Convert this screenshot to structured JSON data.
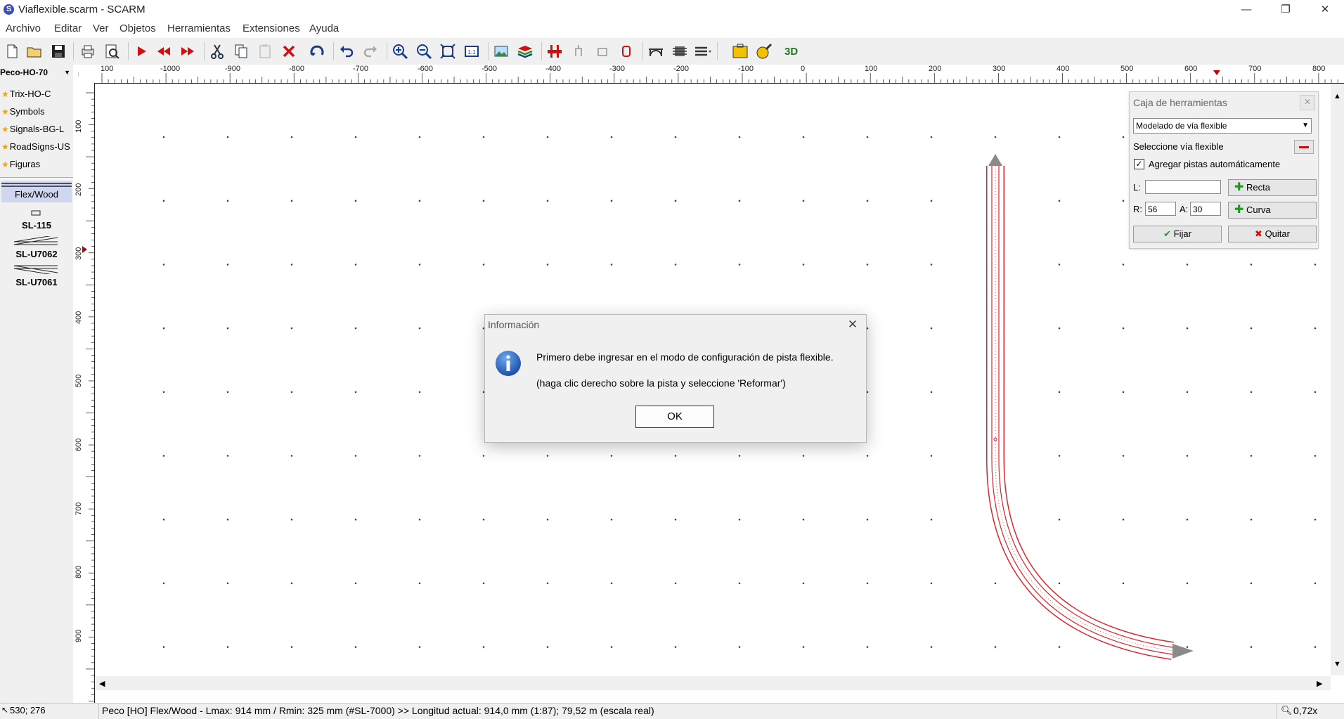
{
  "window": {
    "title": "Viaflexible.scarm - SCARM",
    "app_icon_letter": "S",
    "minimize": "—",
    "restore": "❐",
    "close": "✕"
  },
  "menu": [
    "Archivo",
    "Editar",
    "Ver",
    "Objetos",
    "Herramientas",
    "Extensiones",
    "Ayuda"
  ],
  "toolbar_icons": [
    "new-file-icon",
    "open-folder-icon",
    "save-icon",
    "print-icon",
    "print-preview-icon",
    "arrow-right-icon",
    "arrow-double-left-icon",
    "arrow-double-right-icon",
    "cut-icon",
    "copy-icon",
    "paste-icon",
    "delete-icon",
    "rotate-icon",
    "undo-icon",
    "redo-icon",
    "zoom-in-icon",
    "zoom-out-icon",
    "zoom-fit-icon",
    "zoom-1to1-icon",
    "background-image-icon",
    "layers-icon",
    "track-tool-icon",
    "elevation-icon",
    "grade-icon",
    "height-icon",
    "bridge-icon",
    "tunnel-icon",
    "grid-menu-icon",
    "toolbox-icon",
    "measure-icon",
    "3d-view-icon"
  ],
  "toolbar_3d_label": "3D",
  "library": {
    "selected": "Peco-HO-70",
    "favorites": [
      "Trix-HO-C",
      "Symbols",
      "Signals-BG-L",
      "RoadSigns-US",
      "Figuras"
    ],
    "active_tab": "Flex/Wood",
    "tiles": [
      "SL-115",
      "SL-U7062",
      "SL-U7061"
    ]
  },
  "ruler": {
    "unit": "mm",
    "top_labels": [
      "100",
      "-1000",
      "-900",
      "-800",
      "-700",
      "-600",
      "-500",
      "-400",
      "-300",
      "-200",
      "-100",
      "0",
      "100",
      "200",
      "300",
      "400",
      "500",
      "600",
      "700",
      "800"
    ],
    "left_labels": [
      "100",
      "200",
      "300",
      "400",
      "500",
      "600",
      "700",
      "800",
      "900"
    ]
  },
  "toolbox": {
    "title": "Caja de herramientas",
    "mode": "Modelado de vía flexible",
    "select_label": "Seleccione vía flexible",
    "auto_tracks_label": "Agregar pistas automáticamente",
    "auto_tracks_checked": true,
    "l_label": "L:",
    "l_value": "",
    "r_label": "R:",
    "r_value": "56",
    "a_label": "A:",
    "a_value": "30",
    "straight_button": "Recta",
    "curve_button": "Curva",
    "fix_button": "Fijar",
    "remove_button": "Quitar"
  },
  "dialog": {
    "title": "Información",
    "message1": "Primero debe ingresar en el modo de configuración de pista flexible.",
    "message2": "(haga clic derecho sobre la pista y seleccione 'Reformar')",
    "ok_button": "OK",
    "close": "✕"
  },
  "status": {
    "coords": "530; 276",
    "info": "Peco [HO] Flex/Wood - Lmax: 914 mm / Rmin: 325 mm (#SL-7000)  >>  Longitud actual: 914,0 mm (1:87); 79,52 m (escala real)",
    "zoom": "0,72x"
  },
  "colors": {
    "track": "#e0242c",
    "track_end": "#8a8a8a",
    "accent_green": "#1a9a1a",
    "accent_red": "#d01010"
  }
}
